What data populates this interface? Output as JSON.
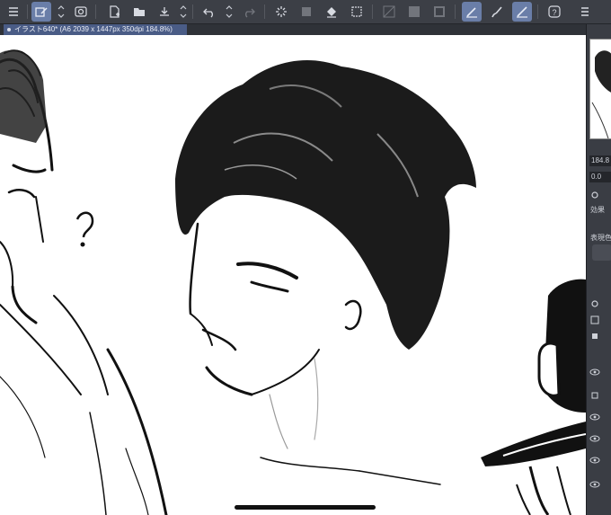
{
  "document_tab": {
    "title": "イラスト640* (A6 2039 x 1447px 350dpi 184.8%)"
  },
  "toolbar": {
    "icons": [
      "menu-icon",
      "new-layer-icon",
      "layer-visibility-icon",
      "new-file-icon",
      "open-folder-icon",
      "save-icon",
      "undo-icon",
      "redo-icon",
      "loading-icon",
      "fill-icon",
      "transform-icon",
      "pen-icon",
      "brush-icon",
      "line-icon",
      "help-icon"
    ]
  },
  "right_panel": {
    "zoom_value": "184.8",
    "rotation_value": "0.0",
    "effect_label": "効果",
    "expression_label": "表現色"
  },
  "colors": {
    "toolbar_bg": "#3c3f46",
    "active_tool": "#6a7ea8",
    "tab_active": "#4a5c86",
    "panel_bg": "#3a3d44"
  }
}
